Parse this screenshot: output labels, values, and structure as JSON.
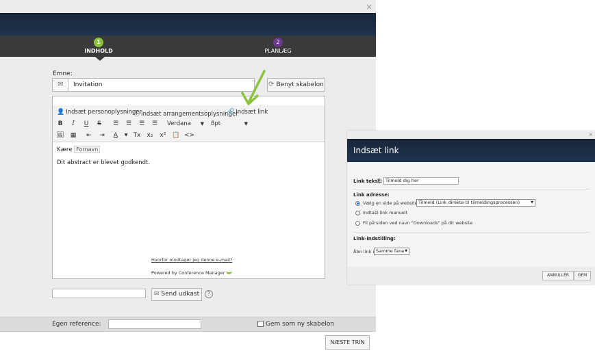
{
  "main_window": {
    "close_glyph": "×",
    "steps": [
      {
        "number": "1",
        "label": "INDHOLD"
      },
      {
        "number": "2",
        "label": "PLANLÆG"
      }
    ],
    "subject": {
      "label": "Emne:",
      "value": "Invitation"
    },
    "template_button": "Benyt skabelon",
    "editor": {
      "insert_person": "Indsæt personoplysninger",
      "insert_event": "Indsæt arrangementsoplysninger",
      "insert_link": "Indsæt link",
      "font_family": "Verdana",
      "font_size": "8pt",
      "body": {
        "greeting": "Kære",
        "firstname_tag": "Fornavn",
        "text": "Dit abstract er blevet godkendt."
      },
      "why_link": "Hvorfor modtager jeg denne e-mail?",
      "powered_by": "Powered by Conference Manager"
    },
    "send_draft_button": "Send udkast",
    "footer": {
      "reference_label": "Egen reference:",
      "save_template_label": "Gem som ny skabelon"
    },
    "next_step_button": "NÆSTE TRIN"
  },
  "link_dialog": {
    "title": "Indsæt link",
    "close_glyph": "×",
    "link_text_label": "Link tekst:",
    "link_text_value": "Tilmeld dig her",
    "link_address_label": "Link adresse:",
    "options": [
      {
        "label": "Vælg en side på websitet",
        "selected": true
      },
      {
        "label": "Indtast link manuelt",
        "selected": false
      },
      {
        "label": "Fil på siden ved navn \"Downloads\" på dit website",
        "selected": false
      }
    ],
    "page_select_value": "Tilmeld (Link direkte til tilmeldingsprocessen)",
    "link_settings_label": "Link-indstilling:",
    "open_in_label": "Åbn link i",
    "open_in_value": "Samme fane",
    "cancel_button": "ANNULLÉR",
    "save_button": "GEM"
  },
  "colors": {
    "header_dark": "#1e3450",
    "step_active": "#8dc23f",
    "step_inactive": "#6a3a8c",
    "arrow": "#8dc23f"
  }
}
